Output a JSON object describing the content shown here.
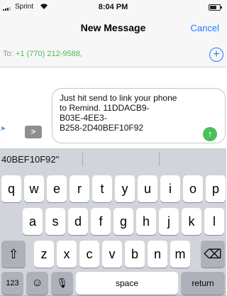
{
  "status_bar": {
    "carrier": "Sprint",
    "time": "8:04 PM"
  },
  "nav": {
    "title": "New Message",
    "cancel_label": "Cancel"
  },
  "to_field": {
    "label": "To:",
    "recipient": "+1 (770) 212-9588,"
  },
  "composer": {
    "message": "Just hit send to link your phone\nto Remind. 11DDACB9-\nB03E-4EE3-\nB258-2D40BEF10F92",
    "expand_glyph": ">",
    "send_glyph": "↑",
    "add_glyph": "+"
  },
  "keyboard": {
    "suggestion": "40BEF10F92\"",
    "row1": [
      "q",
      "w",
      "e",
      "r",
      "t",
      "y",
      "u",
      "i",
      "o",
      "p"
    ],
    "row2": [
      "a",
      "s",
      "d",
      "f",
      "g",
      "h",
      "j",
      "k",
      "l"
    ],
    "row3": [
      "z",
      "x",
      "c",
      "v",
      "b",
      "n",
      "m"
    ],
    "shift_glyph": "⇧",
    "delete_glyph": "⌫",
    "numbers_label": "123",
    "emoji_glyph": "☺",
    "mic_glyph": "🎙",
    "space_label": "space",
    "return_label": "return"
  }
}
